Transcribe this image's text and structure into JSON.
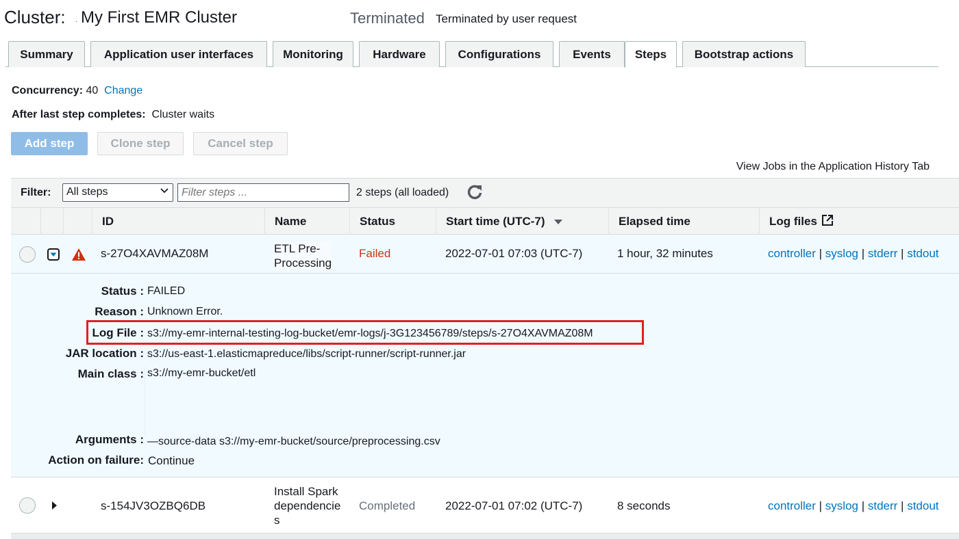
{
  "header": {
    "label": "Cluster:",
    "name": "My First EMR Cluster",
    "state": "Terminated",
    "reason": "Terminated by user request"
  },
  "tabs": [
    "Summary",
    "Application user interfaces",
    "Monitoring",
    "Hardware",
    "Configurations",
    "Events",
    "Steps",
    "Bootstrap actions"
  ],
  "active_tab": "Steps",
  "concurrency": {
    "label": "Concurrency:",
    "value": "40",
    "change": "Change"
  },
  "after_last": {
    "label": "After last step completes:",
    "value": "Cluster waits"
  },
  "buttons": {
    "add": "Add step",
    "clone": "Clone step",
    "cancel": "Cancel step"
  },
  "view_jobs": "View Jobs in the Application History Tab",
  "filter": {
    "label": "Filter:",
    "selected": "All steps",
    "placeholder": "Filter steps ...",
    "count": "2 steps (all loaded)"
  },
  "columns": {
    "id": "ID",
    "name": "Name",
    "status": "Status",
    "start": "Start time (UTC-7)",
    "elapsed": "Elapsed time",
    "logs": "Log files"
  },
  "steps": [
    {
      "id": "s-27O4XAVMAZ08M",
      "name_line1": "ETL Pre-",
      "name_line2": "Processing",
      "status": "Failed",
      "start": "2022-07-01 07:03 (UTC-7)",
      "elapsed": "1 hour, 32 minutes",
      "logs": [
        "controller",
        "syslog",
        "stderr",
        "stdout"
      ]
    },
    {
      "id": "s-154JV3OZBQ6DB",
      "name_line1": "Install Spark",
      "name_line2": "dependencie",
      "name_line3": "s",
      "status": "Completed",
      "start": "2022-07-01 07:02 (UTC-7)",
      "elapsed": "8 seconds",
      "logs": [
        "controller",
        "syslog",
        "stderr",
        "stdout"
      ]
    }
  ],
  "details": {
    "status_label": "Status :",
    "status_value": "FAILED",
    "reason_label": "Reason :",
    "reason_value": "Unknown Error.",
    "logfile_label": "Log File :",
    "logfile_value": "s3://my-emr-internal-testing-log-bucket/emr-logs/j-3G123456789/steps/s-27O4XAVMAZ08M",
    "jar_label": "JAR location :",
    "jar_value": "s3://us-east-1.elasticmapreduce/libs/script-runner/script-runner.jar",
    "main_label": "Main class :",
    "main_value": "s3://my-emr-bucket/etl",
    "args_label": "Arguments :",
    "args_value": "—source-data s3://my-emr-bucket/source/preprocessing.csv",
    "onfail_label": "Action on failure:",
    "onfail_value": "Continue"
  },
  "colors": {
    "link": "#0073bb",
    "failed": "#d13212",
    "completed": "#687078",
    "primary_disabled": "#8fbde8"
  }
}
